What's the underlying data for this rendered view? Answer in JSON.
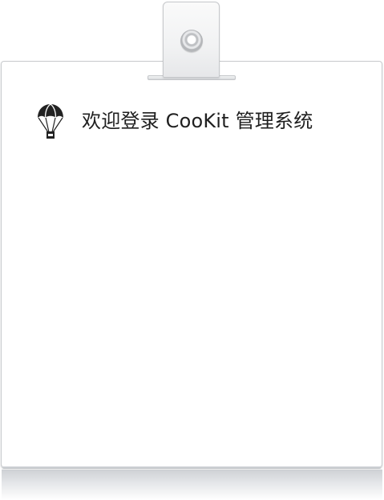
{
  "header": {
    "logo_icon": "parachute-icon",
    "title": "欢迎登录 CooKit 管理系统"
  },
  "colors": {
    "title_text": "#1f1f1f",
    "card_border": "#c9cbce",
    "clip_fill": "#f1f2f3"
  }
}
